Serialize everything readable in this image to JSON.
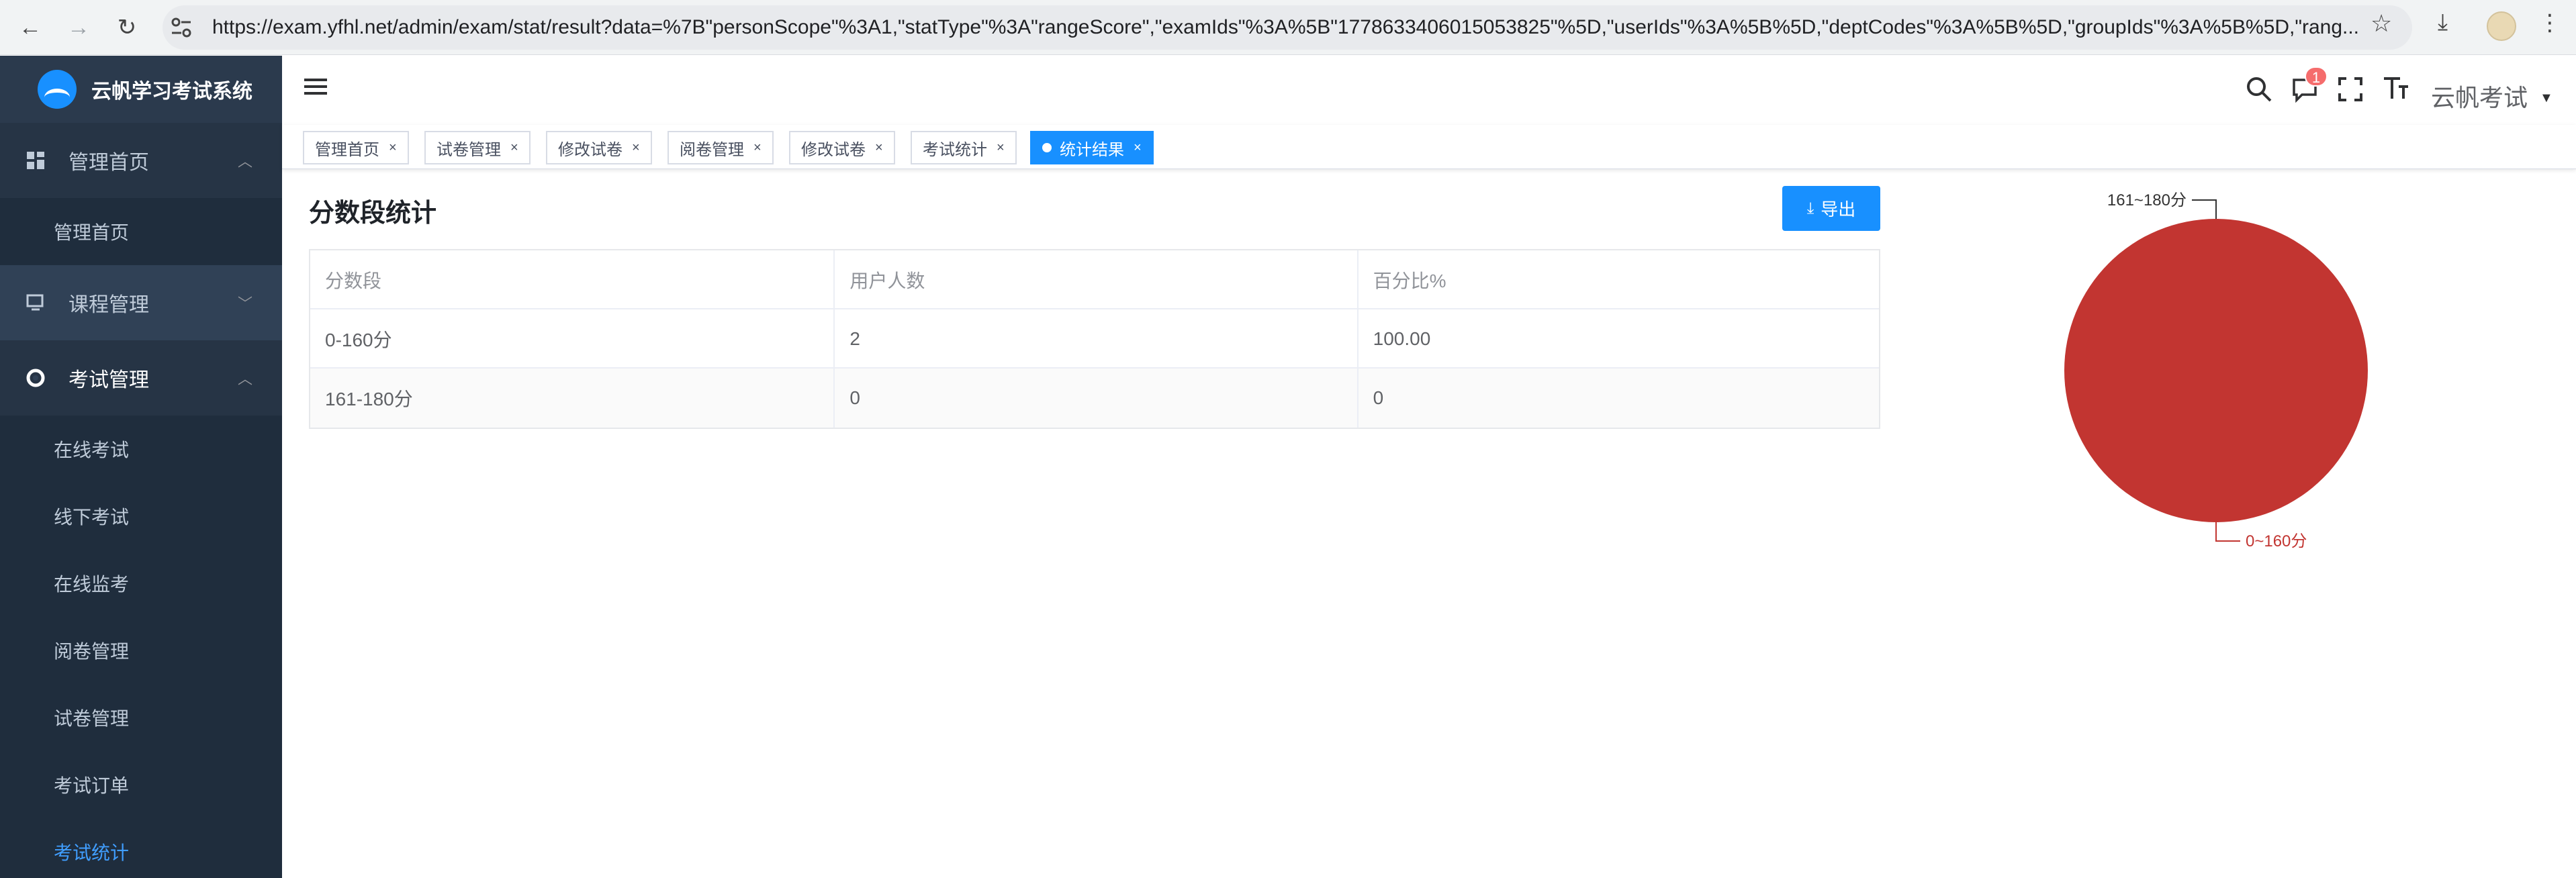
{
  "browser": {
    "url": "https://exam.yfhl.net/admin/exam/stat/result?data=%7B\"personScope\"%3A1,\"statType\"%3A\"rangeScore\",\"examIds\"%3A%5B\"1778633406015053825\"%5D,\"userIds\"%3A%5B%5D,\"deptCodes\"%3A%5B%5D,\"groupIds\"%3A%5B%5D,\"rang..."
  },
  "sidebar": {
    "brand": "云帆学习考试系统",
    "groups": [
      {
        "label": "管理首页",
        "icon": "dashboard-icon",
        "expanded": true,
        "items": [
          "管理首页"
        ]
      },
      {
        "label": "课程管理",
        "icon": "monitor-icon",
        "expanded": false,
        "items": []
      },
      {
        "label": "考试管理",
        "icon": "lifebuoy-icon",
        "expanded": true,
        "items": [
          "在线考试",
          "线下考试",
          "在线监考",
          "阅卷管理",
          "试卷管理",
          "考试订单",
          "考试统计"
        ]
      }
    ],
    "active_item": "考试统计"
  },
  "header": {
    "notification_count": "1",
    "user_name": "云帆考试"
  },
  "tags": [
    {
      "label": "管理首页",
      "active": false
    },
    {
      "label": "试卷管理",
      "active": false
    },
    {
      "label": "修改试卷",
      "active": false
    },
    {
      "label": "阅卷管理",
      "active": false
    },
    {
      "label": "修改试卷",
      "active": false
    },
    {
      "label": "考试统计",
      "active": false
    },
    {
      "label": "统计结果",
      "active": true
    }
  ],
  "main": {
    "title": "分数段统计",
    "export_label": "导出",
    "table": {
      "columns": [
        "分数段",
        "用户人数",
        "百分比%"
      ],
      "rows": [
        [
          "0-160分",
          "2",
          "100.00"
        ],
        [
          "161-180分",
          "0",
          "0"
        ]
      ]
    }
  },
  "chart_data": {
    "type": "pie",
    "categories": [
      "0~160分",
      "161~180分"
    ],
    "values": [
      2,
      0
    ],
    "colors": [
      "#c23531",
      "#2f4554"
    ],
    "title": ""
  }
}
